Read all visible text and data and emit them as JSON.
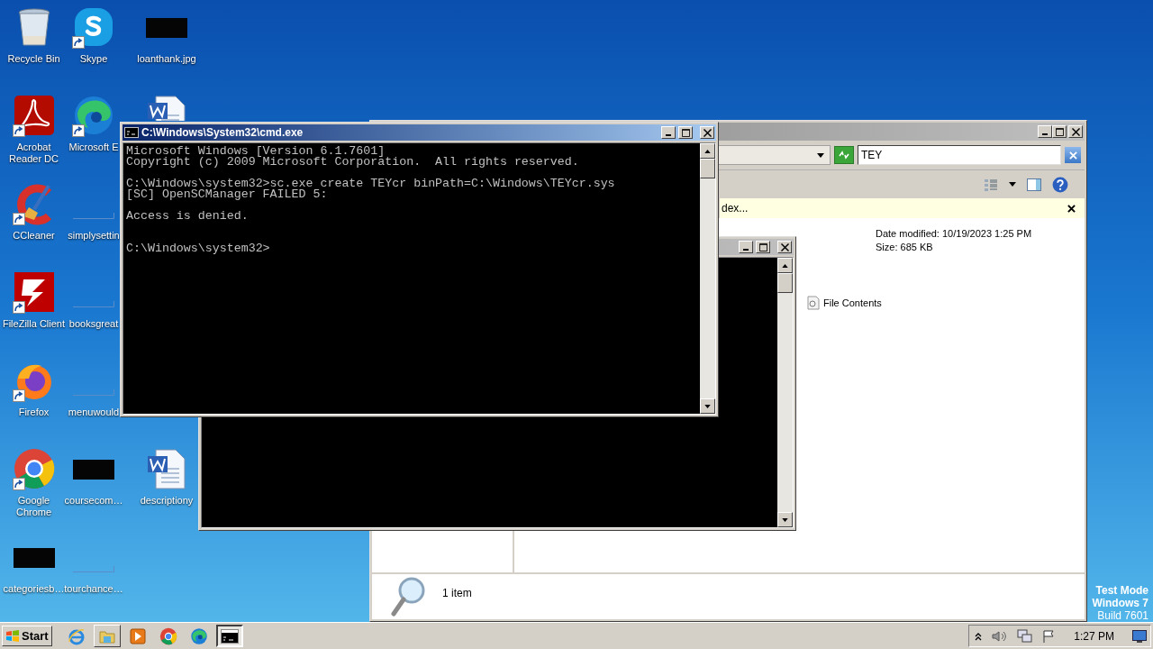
{
  "desktop": {
    "columns": [
      [
        {
          "kind": "recycle-bin",
          "label": [
            "Recycle Bin"
          ],
          "shortcut": false
        },
        {
          "kind": "acrobat",
          "label": [
            "Acrobat",
            "Reader DC"
          ],
          "shortcut": true
        },
        {
          "kind": "ccleaner",
          "label": [
            "CCleaner"
          ],
          "shortcut": true
        },
        {
          "kind": "filezilla",
          "label": [
            "FileZilla Client"
          ],
          "shortcut": true
        },
        {
          "kind": "firefox",
          "label": [
            "Firefox"
          ],
          "shortcut": true
        },
        {
          "kind": "chrome",
          "label": [
            "Google",
            "Chrome"
          ],
          "shortcut": true
        },
        {
          "kind": "dark-image",
          "label": [
            "categoriesb…"
          ],
          "shortcut": false
        }
      ],
      [
        {
          "kind": "skype",
          "label": [
            "Skype"
          ],
          "shortcut": true
        },
        {
          "kind": "edge",
          "label": [
            "Microsoft E"
          ],
          "shortcut": true
        },
        {
          "kind": "blank",
          "label": [
            "simplysettin"
          ],
          "shortcut": false
        },
        {
          "kind": "blank",
          "label": [
            "booksgreat"
          ],
          "shortcut": false
        },
        {
          "kind": "blank",
          "label": [
            "menuwould"
          ],
          "shortcut": false
        },
        {
          "kind": "dark-image",
          "label": [
            "coursecom…"
          ],
          "shortcut": false
        },
        {
          "kind": "blank",
          "label": [
            "tourchance…"
          ],
          "shortcut": false
        }
      ],
      [
        {
          "kind": "dark-image",
          "label": [
            "loanthank.jpg"
          ],
          "shortcut": false
        },
        {
          "kind": "word",
          "shortcut": false
        },
        {
          "kind": "word",
          "label": [
            "descriptiony"
          ],
          "shortcut": false
        }
      ]
    ]
  },
  "test_mode_notice": [
    "Test Mode",
    "Windows 7",
    "Build 7601"
  ],
  "explorer": {
    "active": false,
    "search": {
      "value": "TEY"
    },
    "info_bar": "dex...",
    "details": [
      "Date modified: 10/19/2023 1:25 PM",
      "Size: 685 KB"
    ],
    "file_contents": "File Contents",
    "status": "1 item"
  },
  "console_back": {
    "active": false
  },
  "console_front": {
    "active": true,
    "title": "C:\\Windows\\System32\\cmd.exe",
    "output": "Microsoft Windows [Version 6.1.7601]\nCopyright (c) 2009 Microsoft Corporation.  All rights reserved.\n\nC:\\Windows\\system32>sc.exe create TEYcr binPath=C:\\Windows\\TEYcr.sys\n[SC] OpenSCManager FAILED 5:\n\nAccess is denied.\n\n\nC:\\Windows\\system32>"
  },
  "taskbar": {
    "start": "Start",
    "items": [
      {
        "kind": "ie",
        "open": false,
        "active": false
      },
      {
        "kind": "explorer",
        "open": true,
        "active": false
      },
      {
        "kind": "media",
        "open": false,
        "active": false
      },
      {
        "kind": "chrome",
        "open": false,
        "active": false
      },
      {
        "kind": "edge",
        "open": false,
        "active": false
      },
      {
        "kind": "cmd",
        "open": true,
        "active": true
      }
    ],
    "clock": "1:27 PM"
  }
}
